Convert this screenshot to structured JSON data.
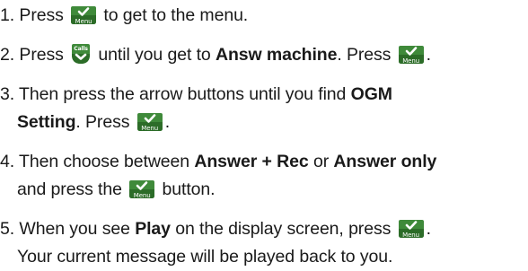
{
  "instructions": {
    "step1": {
      "num": "1.",
      "pre": "Press",
      "post": "to get to the menu.",
      "key_label": "Menu"
    },
    "step2": {
      "num": "2.",
      "pre": "Press",
      "calls_label": "Calls",
      "mid": "until you get to",
      "bold": "Answ machine",
      "mid2": ". Press",
      "key_label": "Menu",
      "post": "."
    },
    "step3": {
      "num": "3.",
      "pre": "Then press the arrow buttons until you find",
      "bold": "OGM",
      "bold2": "Setting",
      "mid": ". Press",
      "key_label": "Menu",
      "post": "."
    },
    "step4": {
      "num": "4.",
      "pre": "Then choose between",
      "bold": "Answer + Rec",
      "mid": "or",
      "bold2": "Answer only",
      "line2_pre": "and press the",
      "key_label": "Menu",
      "post": "button."
    },
    "step5": {
      "num": "5.",
      "pre": "When you see",
      "bold": "Play",
      "mid": "on the display screen, press",
      "key_label": "Menu",
      "post": ".",
      "line2": "Your current message will be played back to you."
    }
  },
  "colors": {
    "key_green": "#3f8a3a",
    "key_green_dark": "#2c6c28",
    "text": "#1a1a1a"
  },
  "icons": {
    "menu_key": "menu-key-icon",
    "calls_key": "calls-key-icon"
  }
}
